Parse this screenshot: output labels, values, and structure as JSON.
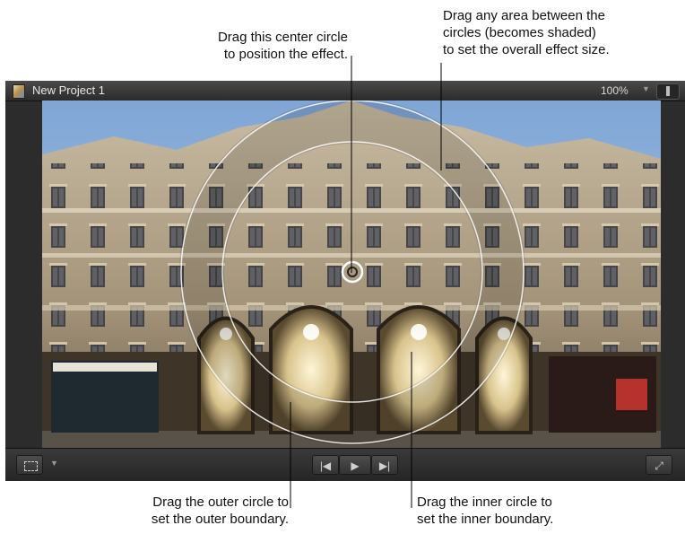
{
  "callouts": {
    "center": [
      "Drag this center circle",
      "to position the effect."
    ],
    "area": [
      "Drag any area between the",
      "circles (becomes shaded)",
      "to set the overall effect size."
    ],
    "outer": [
      "Drag the outer circle to",
      "set the outer boundary."
    ],
    "inner": [
      "Drag the inner circle to",
      "set the inner boundary."
    ]
  },
  "viewer": {
    "project_title": "New Project 1",
    "zoom_level": "100%"
  },
  "icons": {
    "project": "project-icon",
    "zoom_menu": "chevron-down-icon",
    "view_options": "view-options-icon",
    "transform": "transform-icon",
    "transform_menu": "chevron-down-icon",
    "previous": "skip-back-icon",
    "play": "play-icon",
    "next": "skip-forward-icon",
    "fullscreen": "fullscreen-icon"
  },
  "colors": {
    "viewer_bg": "#2c2c2c",
    "sky": "#8fb3dc",
    "stone": "#b7a88f",
    "effect_ring": "#ffffff"
  }
}
